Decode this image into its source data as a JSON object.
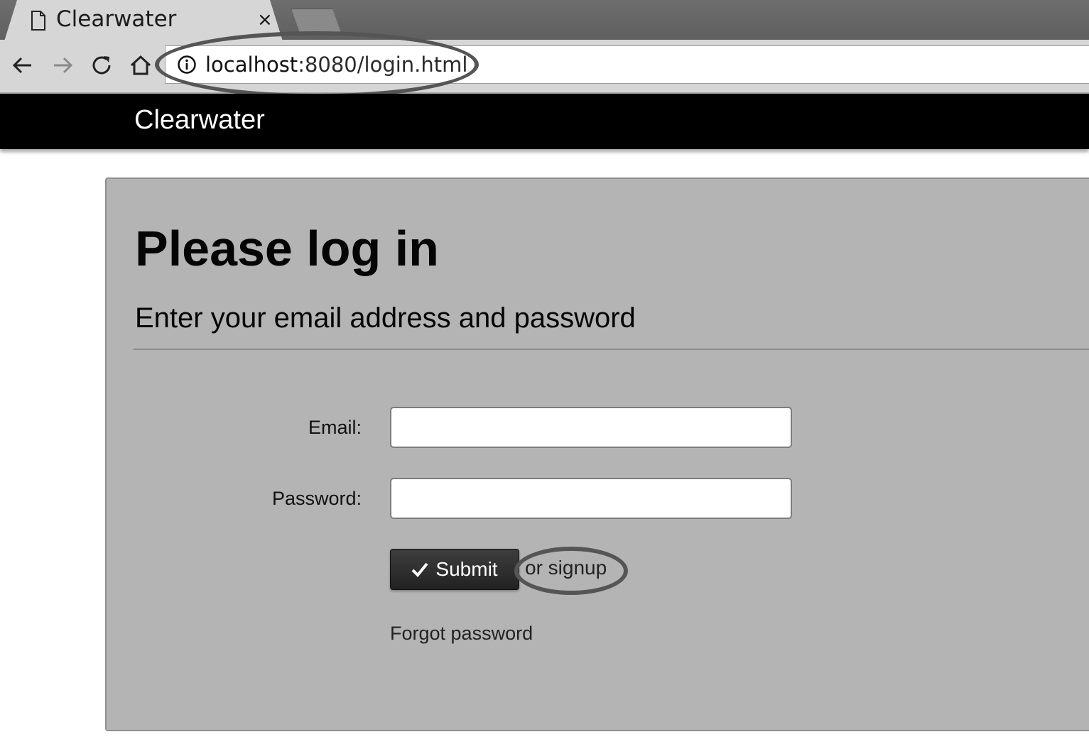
{
  "browser": {
    "tab_title": "Clearwater",
    "tab_close": "×",
    "url_host": "localhost",
    "url_rest": ":8080/login.html"
  },
  "icons": {
    "tab": "page-icon",
    "back": "back-arrow-icon",
    "forward": "forward-arrow-icon",
    "reload": "reload-icon",
    "home": "home-icon",
    "site_info": "info-icon",
    "submit": "checkmark-icon"
  },
  "navbar": {
    "brand": "Clearwater"
  },
  "login": {
    "heading": "Please log in",
    "subheading": "Enter your email address and password",
    "email_label": "Email:",
    "email_value": "",
    "password_label": "Password:",
    "password_value": "",
    "submit_label": "Submit",
    "signup_link": "or signup",
    "forgot_link": "Forgot password"
  },
  "colors": {
    "navbar_bg": "#000000",
    "panel_bg": "#b4b4b4",
    "button_bg": "#2e2e2e",
    "annotation_stroke": "#555555"
  }
}
